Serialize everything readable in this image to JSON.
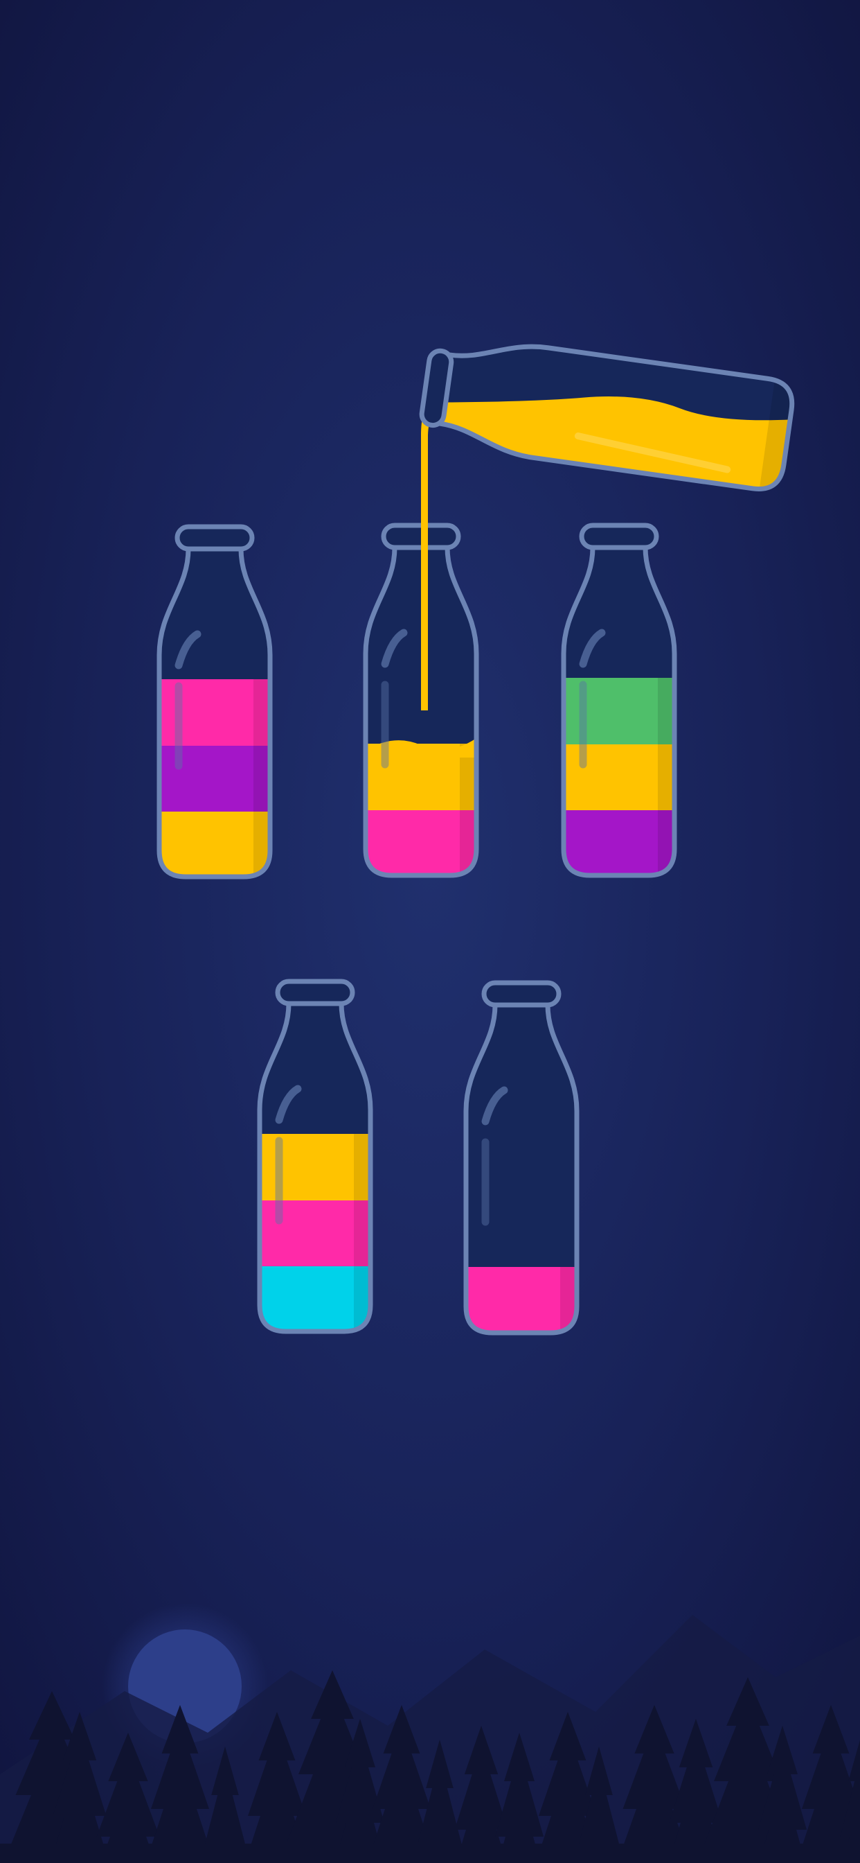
{
  "game": {
    "colors": {
      "background_center": "#20306e",
      "background_edge": "#111641",
      "bottle_glass": "#16275a",
      "bottle_outline": "#6c84b4",
      "highlight": "#5a73a6",
      "moon": "#2d3f8a",
      "moon_glow": "#2a3a86",
      "forest": "#0f1330",
      "mountains": "#151c45",
      "pink": "#ff2aa8",
      "purple": "#a416c8",
      "yellow": "#ffc300",
      "green": "#4fbf6a",
      "cyan": "#00d2ea"
    },
    "pouring": {
      "from": "tilted-bottle",
      "to": "bottle-2",
      "liquid_color": "yellow",
      "liquid_level": 0.55
    },
    "bottles": [
      {
        "id": "bottle-1",
        "layers": [
          "yellow",
          "purple",
          "pink"
        ]
      },
      {
        "id": "bottle-2",
        "layers": [
          "pink",
          "yellow"
        ],
        "receiving_pour": true
      },
      {
        "id": "bottle-3",
        "layers": [
          "purple",
          "yellow",
          "green"
        ]
      },
      {
        "id": "bottle-4",
        "layers": [
          "cyan",
          "pink",
          "yellow"
        ]
      },
      {
        "id": "bottle-5",
        "layers": [
          "pink"
        ]
      }
    ]
  }
}
